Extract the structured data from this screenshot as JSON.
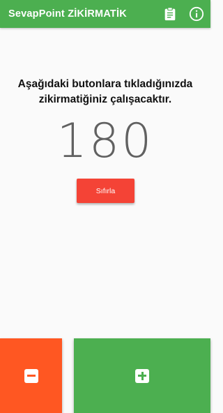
{
  "app": {
    "title": "SevapPoint ZİKİRMATİK",
    "actions": [
      {
        "icon": "clipboard-icon"
      },
      {
        "icon": "info-icon"
      }
    ]
  },
  "main": {
    "instruction": "Aşağıdaki butonlara tıkladığınızda zikirmatiğiniz çalışacaktır.",
    "counter": "180",
    "reset_label": "Sıfırla"
  },
  "controls": {
    "decrement_icon": "minus-icon",
    "increment_icon": "plus-icon"
  },
  "colors": {
    "primary": "#4caf50",
    "reset": "#f44336",
    "decrement": "#ff5722",
    "increment": "#4caf50",
    "counter_text": "#616161"
  }
}
